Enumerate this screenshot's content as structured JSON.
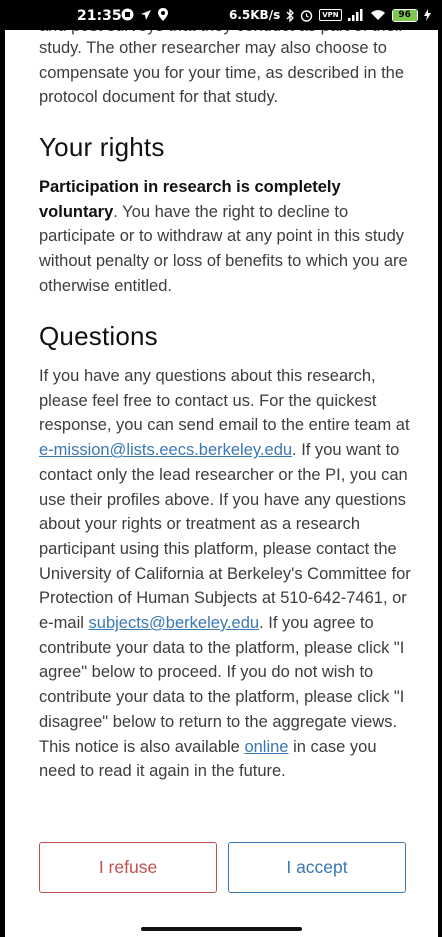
{
  "status_bar": {
    "time": "21:35",
    "network_speed": "6.5KB/s",
    "vpn": "VPN",
    "battery": "96"
  },
  "intro": {
    "partial_line": "and post surveys that they conduct as part of their",
    "text": "study. The other researcher may also choose to compensate you for your time, as described in the protocol document for that study."
  },
  "rights": {
    "heading": "Your rights",
    "bold": "Participation in research is completely voluntary",
    "text": ". You have the right to decline to participate or to withdraw at any point in this study without penalty or loss of benefits to which you are otherwise entitled."
  },
  "questions": {
    "heading": "Questions",
    "text1": "If you have any questions about this research, please feel free to contact us. For the quickest response, you can send email to the entire team at ",
    "email1": "e-mission@lists.eecs.berkeley.edu",
    "text2": ". If you want to contact only the lead researcher or the PI, you can use their profiles above. If you have any questions about your rights or treatment as a research participant using this platform, please contact the University of California at Berkeley's Committee for Protection of Human Subjects at 510-642-7461, or e-mail ",
    "email2": "subjects@berkeley.edu",
    "text3": ". If you agree to contribute your data to the platform, please click \"I agree\" below to proceed. If you do not wish to contribute your data to the platform, please click \"I disagree\" below to return to the aggregate views. This notice is also available ",
    "online_link": "online",
    "text4": " in case you need to read it again in the future."
  },
  "buttons": {
    "refuse": "I refuse",
    "accept": "I accept"
  }
}
